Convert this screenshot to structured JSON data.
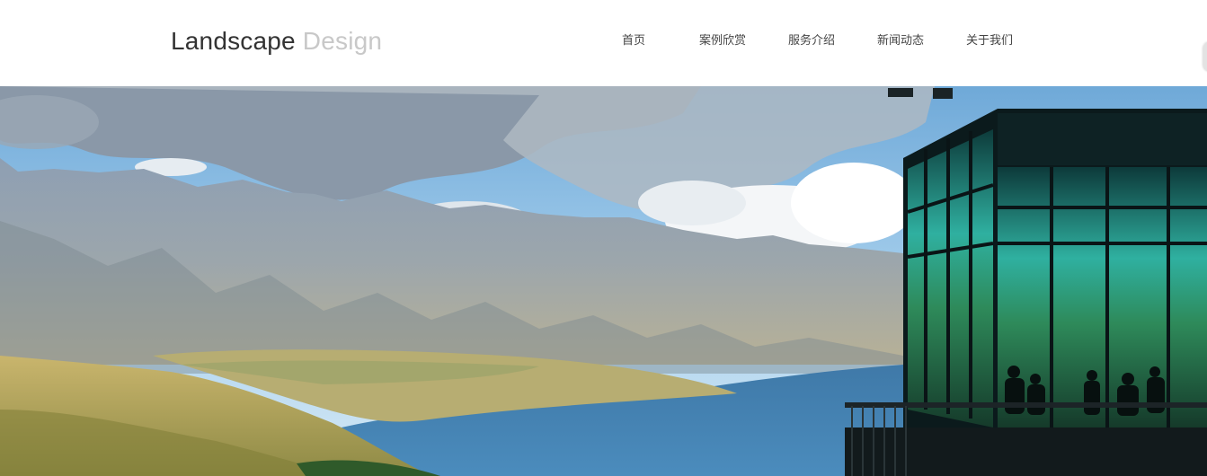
{
  "logo": {
    "word1": "Landscape",
    "word2": "Design"
  },
  "nav": {
    "items": [
      {
        "label": "首页"
      },
      {
        "label": "案例欣赏"
      },
      {
        "label": "服务介绍"
      },
      {
        "label": "新闻动态"
      },
      {
        "label": "关于我们"
      }
    ]
  },
  "colors": {
    "logo_dark": "#333333",
    "logo_light": "#c8c8c8",
    "nav_text": "#444444",
    "header_bg": "#ffffff"
  }
}
